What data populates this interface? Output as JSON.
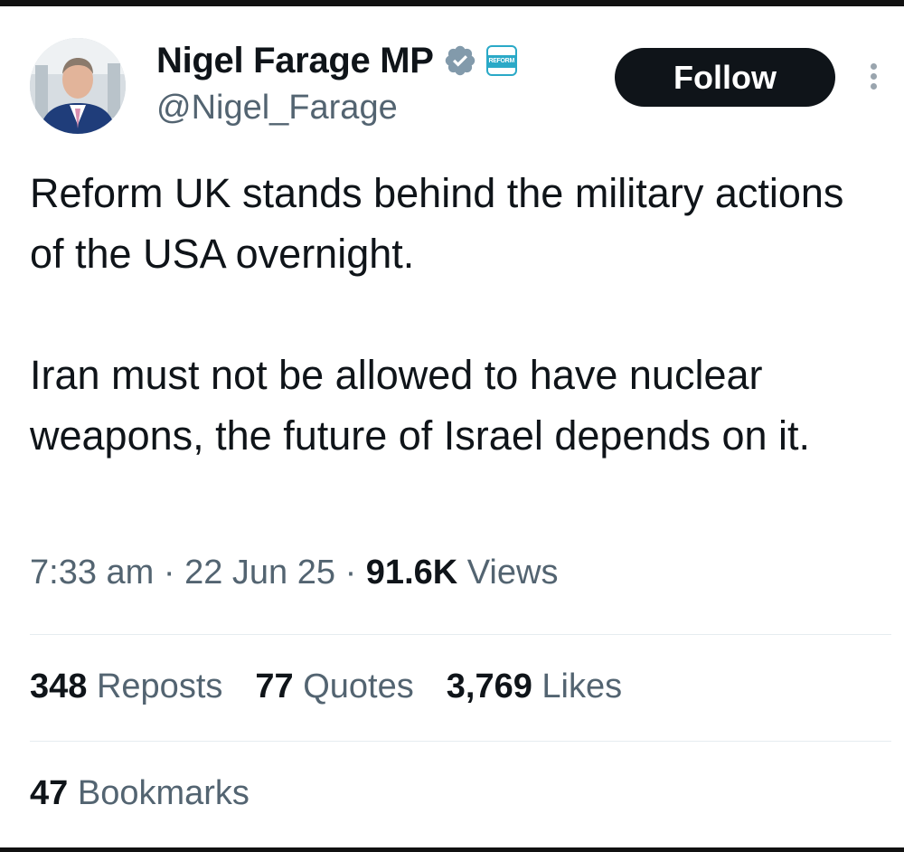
{
  "author": {
    "display_name": "Nigel Farage MP",
    "handle": "@Nigel_Farage",
    "verified_icon": "verified-badge-icon",
    "affiliate_badge_text": "REFORM UK"
  },
  "actions": {
    "follow_label": "Follow",
    "more_icon": "more-options-icon"
  },
  "tweet": {
    "paragraphs": [
      "Reform UK stands behind the military actions of the USA overnight.",
      "Iran must not be allowed to have nuclear weapons, the future of Israel depends on it."
    ]
  },
  "meta": {
    "time": "7:33 am",
    "date": "22 Jun 25",
    "views_count": "91.6K",
    "views_label": "Views",
    "separator": "·"
  },
  "stats": {
    "reposts": {
      "count": "348",
      "label": "Reposts"
    },
    "quotes": {
      "count": "77",
      "label": "Quotes"
    },
    "likes": {
      "count": "3,769",
      "label": "Likes"
    },
    "bookmarks": {
      "count": "47",
      "label": "Bookmarks"
    }
  },
  "colors": {
    "text_primary": "#0f1419",
    "text_secondary": "#536471",
    "follow_bg": "#0f1419",
    "verified": "#829aab",
    "affiliate": "#2aa9c7"
  }
}
